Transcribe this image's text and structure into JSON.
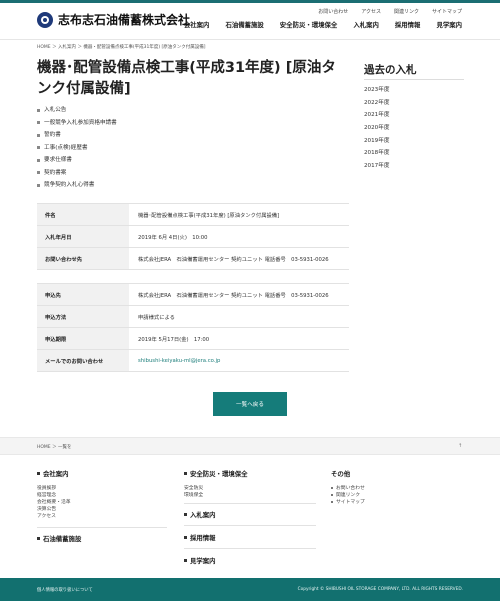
{
  "header": {
    "logo_text": "志布志石油備蓄株式会社",
    "utility_links": [
      "お問い合わせ",
      "アクセス",
      "関連リンク",
      "サイトマップ"
    ],
    "nav": [
      "会社案内",
      "石油備蓄施設",
      "安全防災・環境保全",
      "入札案内",
      "採用情報",
      "見学案内"
    ]
  },
  "breadcrumb": "HOME ＞ 入札案内 ＞ 機器・配管設備点検工事(平成31年度) [原油タンク付属設備]",
  "main": {
    "title": "機器･配管設備点検工事(平成31年度) [原油タンク付属設備]",
    "doc_links": [
      "入札公告",
      "一般競争入札参加資格申請書",
      "誓約書",
      "工事(点検)経歴書",
      "要求仕様書",
      "契約書案",
      "競争契約入札心得書"
    ],
    "table1": [
      {
        "k": "件名",
        "v": "機器･配管設備点検工事(平成31年度) [原油タンク付属設備]"
      },
      {
        "k": "入札年月日",
        "v": "2019年 6月 4日(火)　10:00"
      },
      {
        "k": "お問い合わせ先",
        "v": "株式会社JERA　石油備蓄運用センター 契約ユニット 電話番号　03-5931-0026"
      }
    ],
    "table2": [
      {
        "k": "申込先",
        "v": "株式会社JERA　石油備蓄運用センター 契約ユニット 電話番号　03-5931-0026"
      },
      {
        "k": "申込方法",
        "v": "申請様式による"
      },
      {
        "k": "申込期限",
        "v": "2019年 5月17日(金)　17:00"
      },
      {
        "k": "メールでのお問い合わせ",
        "v": "shibushi-keiyaku-ml@jera.co.jp"
      }
    ],
    "back_button": "一覧へ戻る"
  },
  "sidebar": {
    "title": "過去の入札",
    "years": [
      "2023年度",
      "2022年度",
      "2021年度",
      "2020年度",
      "2019年度",
      "2018年度",
      "2017年度"
    ]
  },
  "footer": {
    "pagetop_left": "HOME ＞ 一覧を",
    "pagetop_right": "↑",
    "col1": {
      "head": "会社案内",
      "items": [
        "役員挨拶",
        "経営理念",
        "会社概要・沿革",
        "決算公告",
        "アクセス"
      ],
      "head2": "石油備蓄施設"
    },
    "col2": {
      "head": "安全防災・環境保全",
      "items": [
        "安全防災",
        "環境保全"
      ],
      "heads": [
        "入札案内",
        "採用情報",
        "見学案内"
      ]
    },
    "col3": {
      "head": "その他",
      "items": [
        "お問い合わせ",
        "関連リンク",
        "サイトマップ"
      ]
    },
    "privacy": "個人情報の取り扱いについて",
    "copyright": "Copyright © SHIBUSHI OIL STORAGE COMPANY, LTD. ALL RIGHTS RESERVED."
  }
}
